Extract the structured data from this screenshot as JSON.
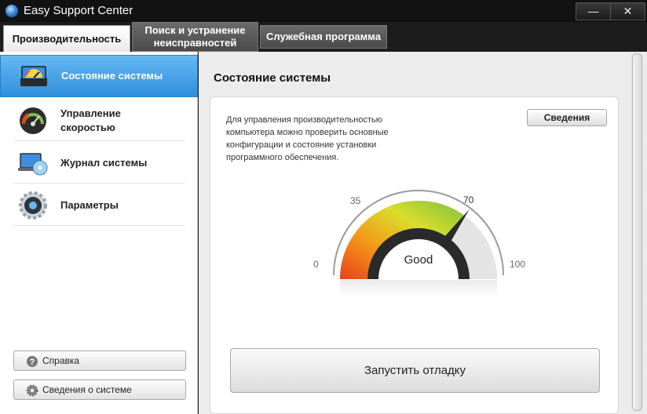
{
  "window": {
    "title": "Easy Support Center",
    "minimize_glyph": "—",
    "close_glyph": "✕"
  },
  "tabs": [
    {
      "label": "Производительность"
    },
    {
      "label": "Поиск и устранение неисправностей"
    },
    {
      "label": "Служебная программа"
    }
  ],
  "sidebar": {
    "items": [
      {
        "label": "Состояние системы",
        "icon": "system-status-icon"
      },
      {
        "label": "Управление скоростью",
        "icon": "speedometer-icon"
      },
      {
        "label": "Журнал системы",
        "icon": "laptop-disc-icon"
      },
      {
        "label": "Параметры",
        "icon": "gear-icon"
      }
    ],
    "help_label": "Справка",
    "sysinfo_label": "Сведения о системе"
  },
  "main": {
    "title": "Состояние системы",
    "description": "Для управления производительностью компьютера можно проверить основные конфигурации и состояние установки программного обеспечения.",
    "details_label": "Сведения",
    "run_label": "Запустить отладку"
  },
  "gauge": {
    "value": 70,
    "status": "Good",
    "labels": {
      "min": "0",
      "low": "35",
      "marker": "70",
      "max": "100"
    },
    "colors": {
      "red": "#e8401c",
      "orange": "#f39a18",
      "yellow": "#d9dd2a",
      "green": "#7cc241"
    }
  }
}
